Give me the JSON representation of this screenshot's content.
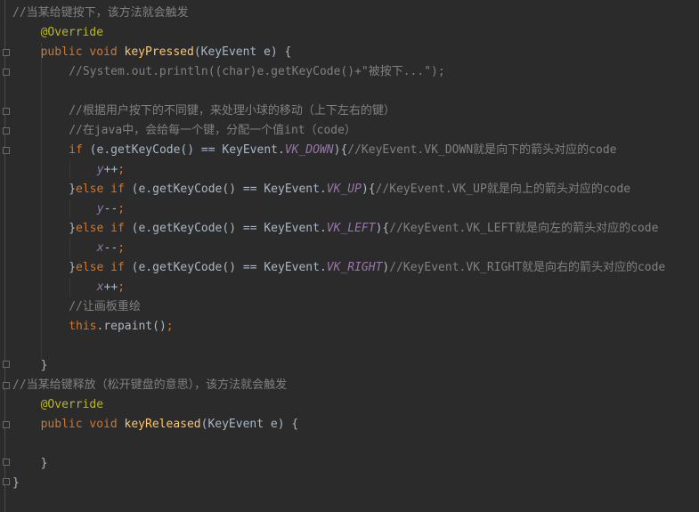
{
  "lines": [
    {
      "indent": 0,
      "tokens": [
        {
          "t": "cm",
          "v": "//当某给键按下，该方法就会触发"
        }
      ]
    },
    {
      "indent": 4,
      "tokens": [
        {
          "t": "ann",
          "v": "@Override"
        }
      ]
    },
    {
      "indent": 4,
      "tokens": [
        {
          "t": "kw",
          "v": "public "
        },
        {
          "t": "kw",
          "v": "void "
        },
        {
          "t": "fn",
          "v": "keyPressed"
        },
        {
          "t": "tx",
          "v": "(KeyEvent e) {"
        }
      ]
    },
    {
      "indent": 8,
      "tokens": [
        {
          "t": "cm",
          "v": "//System.out.println((char)e.getKeyCode()+\"被按下...\");"
        }
      ]
    },
    {
      "indent": 0,
      "tokens": []
    },
    {
      "indent": 8,
      "tokens": [
        {
          "t": "cm",
          "v": "//根据用户按下的不同键，来处理小球的移动（上下左右的键）"
        }
      ]
    },
    {
      "indent": 8,
      "tokens": [
        {
          "t": "cm",
          "v": "//在java中，会给每一个键，分配一个值int（code）"
        }
      ]
    },
    {
      "indent": 8,
      "tokens": [
        {
          "t": "kw",
          "v": "if "
        },
        {
          "t": "tx",
          "v": "(e.getKeyCode() == KeyEvent."
        },
        {
          "t": "cn",
          "v": "VK_DOWN"
        },
        {
          "t": "tx",
          "v": "){"
        },
        {
          "t": "cm",
          "v": "//KeyEvent.VK_DOWN就是向下的箭头对应的code"
        }
      ]
    },
    {
      "indent": 12,
      "tokens": [
        {
          "t": "cn",
          "v": "y"
        },
        {
          "t": "tx",
          "v": "++"
        },
        {
          "t": "kw",
          "v": ";"
        }
      ]
    },
    {
      "indent": 8,
      "tokens": [
        {
          "t": "tx",
          "v": "}"
        },
        {
          "t": "kw",
          "v": "else if "
        },
        {
          "t": "tx",
          "v": "(e.getKeyCode() == KeyEvent."
        },
        {
          "t": "cn",
          "v": "VK_UP"
        },
        {
          "t": "tx",
          "v": "){"
        },
        {
          "t": "cm",
          "v": "//KeyEvent.VK_UP就是向上的箭头对应的code"
        }
      ]
    },
    {
      "indent": 12,
      "tokens": [
        {
          "t": "cn",
          "v": "y"
        },
        {
          "t": "tx",
          "v": "--"
        },
        {
          "t": "kw",
          "v": ";"
        }
      ]
    },
    {
      "indent": 8,
      "tokens": [
        {
          "t": "tx",
          "v": "}"
        },
        {
          "t": "kw",
          "v": "else if "
        },
        {
          "t": "tx",
          "v": "(e.getKeyCode() == KeyEvent."
        },
        {
          "t": "cn",
          "v": "VK_LEFT"
        },
        {
          "t": "tx",
          "v": "){"
        },
        {
          "t": "cm",
          "v": "//KeyEvent.VK_LEFT就是向左的箭头对应的code"
        }
      ]
    },
    {
      "indent": 12,
      "tokens": [
        {
          "t": "cn",
          "v": "x"
        },
        {
          "t": "tx",
          "v": "--"
        },
        {
          "t": "kw",
          "v": ";"
        }
      ]
    },
    {
      "indent": 8,
      "tokens": [
        {
          "t": "tx",
          "v": "}"
        },
        {
          "t": "kw",
          "v": "else if "
        },
        {
          "t": "tx",
          "v": "(e.getKeyCode() == KeyEvent."
        },
        {
          "t": "cn",
          "v": "VK_RIGHT"
        },
        {
          "t": "tx",
          "v": ")"
        },
        {
          "t": "cm",
          "v": "//KeyEvent.VK_RIGHT就是向右的箭头对应的code"
        }
      ]
    },
    {
      "indent": 12,
      "tokens": [
        {
          "t": "cn",
          "v": "x"
        },
        {
          "t": "tx",
          "v": "++"
        },
        {
          "t": "kw",
          "v": ";"
        }
      ]
    },
    {
      "indent": 8,
      "tokens": [
        {
          "t": "cm",
          "v": "//让画板重绘"
        }
      ]
    },
    {
      "indent": 8,
      "tokens": [
        {
          "t": "kw",
          "v": "this"
        },
        {
          "t": "tx",
          "v": ".repaint()"
        },
        {
          "t": "kw",
          "v": ";"
        }
      ]
    },
    {
      "indent": 0,
      "tokens": []
    },
    {
      "indent": 4,
      "tokens": [
        {
          "t": "tx",
          "v": "}"
        }
      ]
    },
    {
      "indent": 0,
      "tokens": [
        {
          "t": "cm",
          "v": "//当某给键释放（松开键盘的意思），该方法就会触发"
        }
      ]
    },
    {
      "indent": 4,
      "tokens": [
        {
          "t": "ann",
          "v": "@Override"
        }
      ]
    },
    {
      "indent": 4,
      "tokens": [
        {
          "t": "kw",
          "v": "public "
        },
        {
          "t": "kw",
          "v": "void "
        },
        {
          "t": "fn",
          "v": "keyReleased"
        },
        {
          "t": "tx",
          "v": "(KeyEvent e) {"
        }
      ]
    },
    {
      "indent": 0,
      "tokens": []
    },
    {
      "indent": 4,
      "tokens": [
        {
          "t": "tx",
          "v": "}"
        }
      ]
    },
    {
      "indent": 0,
      "tokens": [
        {
          "t": "tx",
          "v": "}"
        }
      ]
    }
  ]
}
